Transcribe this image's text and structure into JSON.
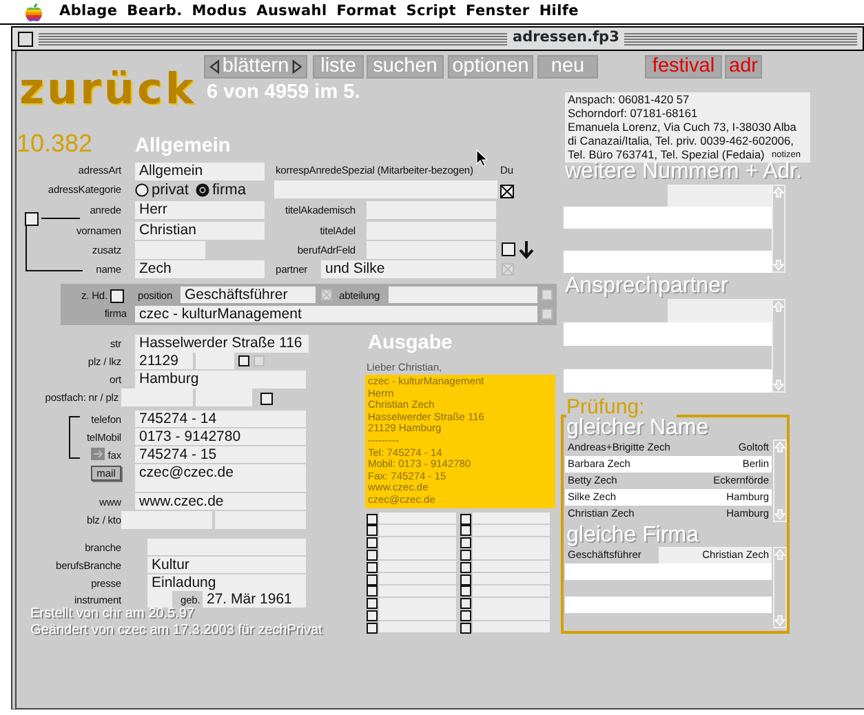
{
  "menu_bar": {
    "items": [
      "Ablage",
      "Bearb.",
      "Modus",
      "Auswahl",
      "Format",
      "Script",
      "Fenster",
      "Hilfe"
    ]
  },
  "window": {
    "title": "adressen.fp3"
  },
  "toolbar": {
    "logo": "zurück",
    "record_status": "6 von 4959 im 5.",
    "buttons": [
      {
        "label": "blättern",
        "kind": "browse"
      },
      {
        "label": "liste",
        "kind": "plain"
      },
      {
        "label": "suchen",
        "kind": "plain"
      },
      {
        "label": "optionen",
        "kind": "plain"
      },
      {
        "label": "neu",
        "kind": "plain"
      },
      {
        "label": "festival",
        "kind": "alert"
      },
      {
        "label": "adr",
        "kind": "alert"
      }
    ]
  },
  "notes": {
    "label": "notizen",
    "lines": [
      "Anspach: 06081-420 57",
      "Schorndorf: 07181-68161",
      "Emanuela Lorenz, Via Cuch 73, I-38030 Alba",
      "di Canazai/Italia, Tel. priv. 0039-462-602006,",
      "Tel. Büro 763741, Tel. Spezial (Fedaia)"
    ]
  },
  "record_number": "10.382",
  "general": {
    "title": "Allgemein",
    "items": [
      {
        "kind": "label",
        "text": "adressArt"
      },
      {
        "kind": "field",
        "value": "Allgemein"
      },
      {
        "kind": "label",
        "text": "korrespAnredeSpezial (Mitarbeiter-bezogen)"
      },
      {
        "kind": "label",
        "text": "Du"
      },
      {
        "kind": "label",
        "text": "adressKategorie"
      },
      {
        "kind": "radio",
        "label": "privat",
        "selected": false
      },
      {
        "kind": "radio",
        "label": "firma",
        "selected": true
      },
      {
        "kind": "field"
      },
      {
        "kind": "checkbox",
        "checked": true,
        "disabled": false
      },
      {
        "kind": "label",
        "text": "anrede"
      },
      {
        "kind": "field",
        "value": "Herr"
      },
      {
        "kind": "label",
        "text": "titelAkademisch"
      },
      {
        "kind": "field"
      },
      {
        "kind": "label",
        "text": "vornamen"
      },
      {
        "kind": "field",
        "value": "Christian"
      },
      {
        "kind": "label",
        "text": "titelAdel"
      },
      {
        "kind": "field"
      },
      {
        "kind": "label",
        "text": "zusatz"
      },
      {
        "kind": "field"
      },
      {
        "kind": "label",
        "text": "berufAdrFeld"
      },
      {
        "kind": "field"
      },
      {
        "kind": "checkbox",
        "checked": false,
        "disabled": false
      },
      {
        "kind": "label",
        "text": "name"
      },
      {
        "kind": "field",
        "value": "Zech"
      },
      {
        "kind": "label",
        "text": "partner"
      },
      {
        "kind": "field",
        "value": "und Silke"
      },
      {
        "kind": "checkbox",
        "checked": true,
        "disabled": true
      },
      {
        "kind": "checkbox",
        "checked": false,
        "disabled": false
      }
    ]
  },
  "contact_panel": {
    "items": [
      {
        "kind": "label",
        "text": "z. Hd."
      },
      {
        "kind": "checkbox",
        "checked": false,
        "disabled": false
      },
      {
        "kind": "label",
        "text": "position"
      },
      {
        "kind": "field",
        "value": "Geschäftsführer"
      },
      {
        "kind": "checkbox",
        "checked": true,
        "disabled": true
      },
      {
        "kind": "label",
        "text": "abteilung"
      },
      {
        "kind": "field"
      },
      {
        "kind": "checkbox",
        "checked": false,
        "disabled": true
      },
      {
        "kind": "label",
        "text": "firma"
      },
      {
        "kind": "field",
        "value": "czec - kulturManagement"
      },
      {
        "kind": "checkbox",
        "checked": false,
        "disabled": true
      }
    ]
  },
  "address": {
    "items": [
      {
        "kind": "label",
        "text": "str"
      },
      {
        "kind": "field",
        "value": "Hasselwerder Straße 116"
      },
      {
        "kind": "label",
        "text": "plz / lkz"
      },
      {
        "kind": "field",
        "value": "21129"
      },
      {
        "kind": "field"
      },
      {
        "kind": "checkbox",
        "checked": false,
        "disabled": false
      },
      {
        "kind": "checkbox",
        "checked": false,
        "disabled": true
      },
      {
        "kind": "label",
        "text": "ort"
      },
      {
        "kind": "field",
        "value": "Hamburg"
      },
      {
        "kind": "label",
        "text": "postfach: nr / plz"
      },
      {
        "kind": "field"
      },
      {
        "kind": "field"
      },
      {
        "kind": "checkbox",
        "checked": false,
        "disabled": false
      },
      {
        "kind": "label",
        "text": "telefon"
      },
      {
        "kind": "field",
        "value": "745274 - 14"
      },
      {
        "kind": "label",
        "text": "telMobil"
      },
      {
        "kind": "field",
        "value": "0173 - 9142780"
      },
      {
        "kind": "label",
        "text": "fax"
      },
      {
        "kind": "field",
        "value": "745274 - 15"
      },
      {
        "kind": "button",
        "label": "mail"
      },
      {
        "kind": "field",
        "value": "czec@czec.de"
      },
      {
        "kind": "label",
        "text": "www"
      },
      {
        "kind": "field",
        "value": "www.czec.de"
      },
      {
        "kind": "label",
        "text": "blz / kto"
      },
      {
        "kind": "field"
      },
      {
        "kind": "field"
      },
      {
        "kind": "label",
        "text": "branche"
      },
      {
        "kind": "field"
      },
      {
        "kind": "label",
        "text": "berufsBranche"
      },
      {
        "kind": "field",
        "value": "Kultur"
      },
      {
        "kind": "label",
        "text": "presse"
      },
      {
        "kind": "field",
        "value": "Einladung"
      },
      {
        "kind": "label",
        "text": "instrument"
      },
      {
        "kind": "field"
      },
      {
        "kind": "label",
        "text": "geb."
      },
      {
        "kind": "field",
        "value": "27. Mär 1961"
      }
    ]
  },
  "footer": {
    "created": "Erstellt von chr am 20.5.97",
    "modified": "Geändert von czec am 17.3.2003 für zechPrivat"
  },
  "output": {
    "title": "Ausgabe",
    "greeting": "Lieber Christian,",
    "letter_lines": [
      "czec - kulturManagement",
      "Herrn",
      "Christian Zech",
      "Hasselwerder Straße 116",
      "21129 Hamburg",
      "---------",
      "Tel: 745274 - 14",
      "Mobil: 0173 - 9142780",
      "Fax: 745274 - 15",
      "www.czec.de",
      "czec@czec.de"
    ],
    "checkboxes": [
      {
        "checked": false
      },
      {
        "checked": false
      },
      {
        "checked": false
      },
      {
        "checked": false
      },
      {
        "checked": false
      },
      {
        "checked": false
      },
      {
        "checked": false
      },
      {
        "checked": false
      },
      {
        "checked": false
      },
      {
        "checked": false
      },
      {
        "checked": false
      },
      {
        "checked": false
      },
      {
        "checked": false
      },
      {
        "checked": false
      },
      {
        "checked": false
      },
      {
        "checked": false
      },
      {
        "checked": false
      },
      {
        "checked": false
      },
      {
        "checked": false
      },
      {
        "checked": false
      }
    ]
  },
  "portals": [
    {
      "title": "weitere Nummern + Adr."
    },
    {
      "title": "Ansprechpartner"
    }
  ],
  "check": {
    "title": "Prüfung:",
    "same_name": {
      "title": "gleicher Name",
      "rows": [
        {
          "name": "Andreas+Brigitte Zech",
          "city": "Goltoft"
        },
        {
          "name": "Barbara Zech",
          "city": "Berlin"
        },
        {
          "name": "Betty Zech",
          "city": "Eckernförde"
        },
        {
          "name": "Silke Zech",
          "city": "Hamburg"
        },
        {
          "name": "Christian Zech",
          "city": "Hamburg"
        }
      ]
    },
    "same_company": {
      "title": "gleiche Firma",
      "rows": [
        {
          "position": "Geschäftsführer",
          "name": "Christian Zech"
        }
      ]
    }
  }
}
